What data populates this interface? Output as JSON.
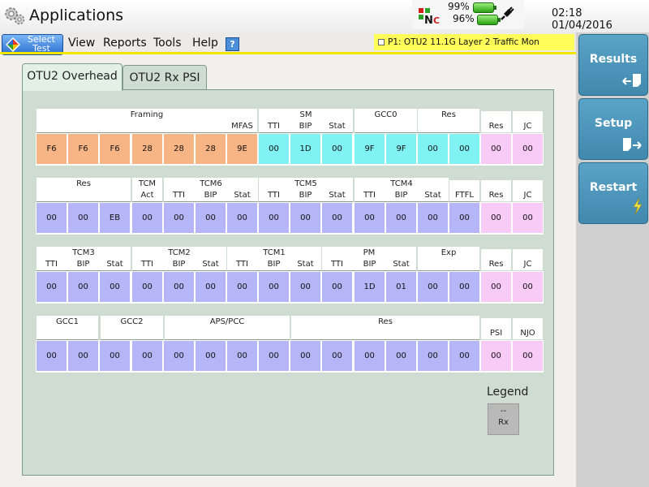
{
  "titlebar": {
    "title": "Applications",
    "battery_top": "99%",
    "battery_bottom": "96%",
    "time": "02:18",
    "date": "01/04/2016"
  },
  "menubar": {
    "select_test_line1": "Select",
    "select_test_line2": "Test",
    "items": [
      "View",
      "Reports",
      "Tools",
      "Help"
    ],
    "help_icon_glyph": "?",
    "port_status": "P1: OTU2 11.1G Layer 2 Traffic Mon"
  },
  "sidebar": {
    "buttons": [
      "Results",
      "Setup",
      "Restart"
    ]
  },
  "tabs": {
    "active": "OTU2 Overhead",
    "inactive": "OTU2 Rx PSI"
  },
  "colors": {
    "orange": "#f7b585",
    "cyan": "#80f2f4",
    "lilac": "#b4b6f8",
    "pink": "#f8caf6"
  },
  "overhead": {
    "row1": {
      "groups": [
        "Framing",
        "SM",
        "GCC0",
        "Res",
        "Res",
        "JC"
      ],
      "sublabels": [
        "MFAS",
        "TTI",
        "BIP",
        "Stat"
      ],
      "values": [
        "F6",
        "F6",
        "F6",
        "28",
        "28",
        "28",
        "9E",
        "00",
        "1D",
        "00",
        "9F",
        "9F",
        "00",
        "00",
        "00",
        "00"
      ]
    },
    "row2": {
      "groups": [
        "Res",
        "TCM",
        "TCM6",
        "TCM5",
        "TCM4",
        "FTFL",
        "Res",
        "JC"
      ],
      "tcm_sub": "Act",
      "sublabels": [
        "TTI",
        "BIP",
        "Stat"
      ],
      "values": [
        "00",
        "00",
        "EB",
        "00",
        "00",
        "00",
        "00",
        "00",
        "00",
        "00",
        "00",
        "00",
        "00",
        "00",
        "00",
        "00"
      ]
    },
    "row3": {
      "groups": [
        "TCM3",
        "TCM2",
        "TCM1",
        "PM",
        "Exp",
        "Res",
        "JC"
      ],
      "sublabels": [
        "TTI",
        "BIP",
        "Stat"
      ],
      "values": [
        "00",
        "00",
        "00",
        "00",
        "00",
        "00",
        "00",
        "00",
        "00",
        "00",
        "1D",
        "01",
        "00",
        "00",
        "00",
        "00"
      ]
    },
    "row4": {
      "groups": [
        "GCC1",
        "GCC2",
        "APS/PCC",
        "Res",
        "PSI",
        "NJO"
      ],
      "values": [
        "00",
        "00",
        "00",
        "00",
        "00",
        "00",
        "00",
        "00",
        "00",
        "00",
        "00",
        "00",
        "00",
        "00",
        "00",
        "00"
      ]
    }
  },
  "legend": {
    "title": "Legend",
    "line1": "--",
    "line2": "Rx"
  }
}
